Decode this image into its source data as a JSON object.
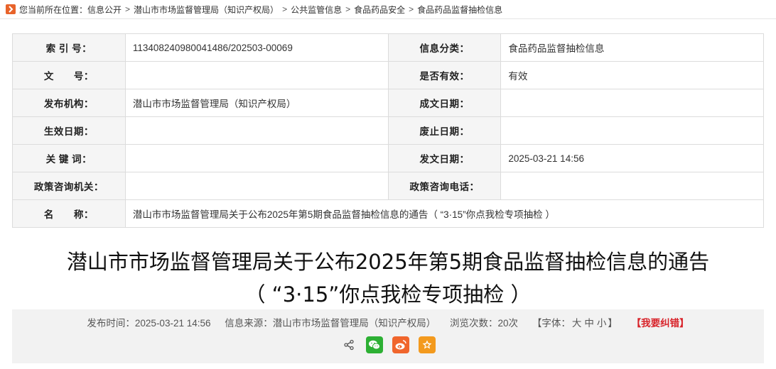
{
  "breadcrumb": {
    "prefix": "您当前所在位置：",
    "items": [
      "信息公开",
      "潜山市市场监督管理局（知识产权局）",
      "公共监管信息",
      "食品药品安全",
      "食品药品监督抽检信息"
    ],
    "separator": ">"
  },
  "meta": {
    "index_label": "索 引 号：",
    "index_value": "11340824098004148​6/202503-00069",
    "category_label": "信息分类：",
    "category_value": "食品药品监督抽检信息",
    "docno_label": "文　　号：",
    "docno_value": "",
    "valid_label": "是否有效：",
    "valid_value": "有效",
    "publisher_label": "发布机构：",
    "publisher_value": "潜山市市场监督管理局（知识产权局）",
    "created_label": "成文日期：",
    "created_value": "",
    "effective_label": "生效日期：",
    "effective_value": "",
    "repeal_label": "废止日期：",
    "repeal_value": "",
    "keywords_label": "关 键 词：",
    "keywords_value": "",
    "pubdate_label": "发文日期：",
    "pubdate_value": "2025-03-21 14:56",
    "consult_org_label": "政策咨询机关：",
    "consult_org_value": "",
    "consult_tel_label": "政策咨询电话：",
    "consult_tel_value": "",
    "name_label": "名　　称：",
    "name_value": "潜山市市场监督管理局关于公布2025年第5期食品监督抽检信息的通告（ “3·15”你点我检专项抽检 ）"
  },
  "article": {
    "title_line1": "潜山市市场监督管理局关于公布2025年第5期食品监督抽检信息的通告",
    "title_line2": "（ “3·15”你点我检专项抽检 ）"
  },
  "info": {
    "published": "发布时间：2025-03-21 14:56",
    "source": "信息来源：潜山市市场监督管理局（知识产权局）",
    "views": "浏览次数：20次",
    "font_prefix": "【字体：",
    "font_large": "大",
    "font_medium": "中",
    "font_small": "小",
    "font_suffix": "】",
    "report": "【我要纠错】"
  },
  "share": {
    "icons": [
      "share-icon",
      "wechat-icon",
      "weibo-icon",
      "favorite-icon"
    ],
    "colors": {
      "wechat": "#2db034",
      "weibo": "#f0652c",
      "favorite": "#f39a1e"
    }
  },
  "colors": {
    "accent_home": "#e8632a",
    "report": "#d8232a"
  }
}
